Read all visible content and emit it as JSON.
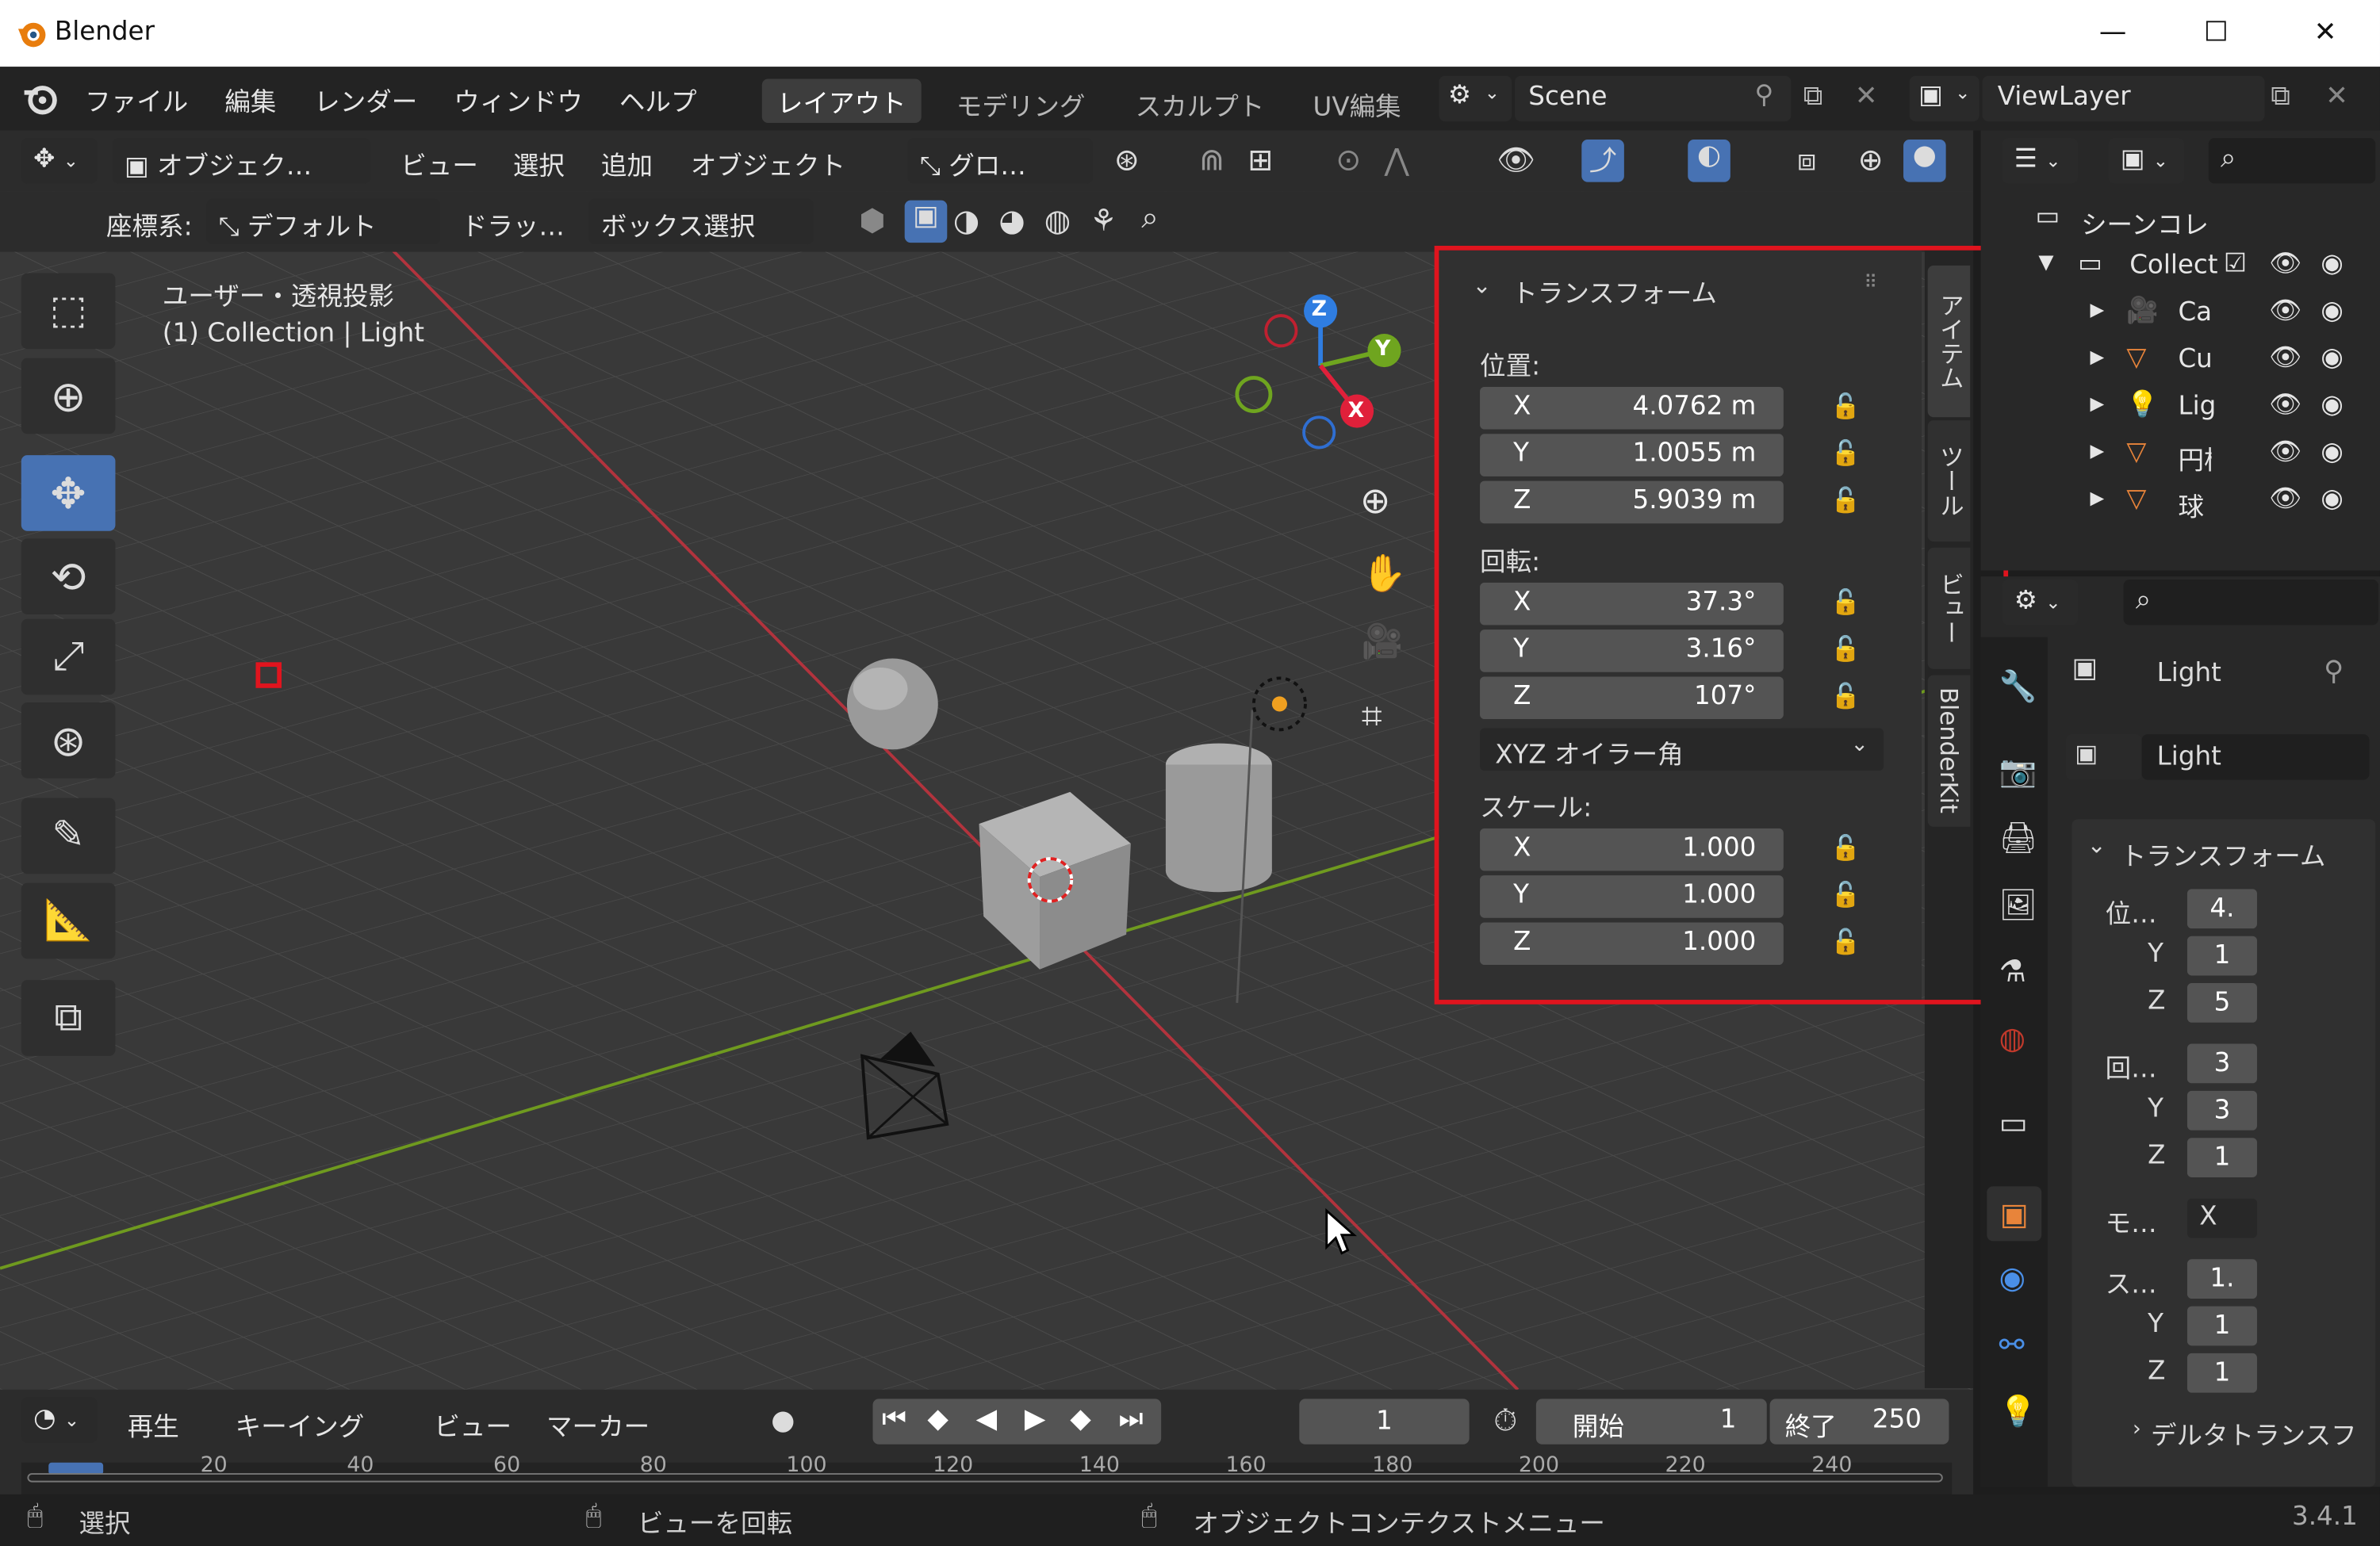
{
  "window": {
    "title": "Blender",
    "minimize": "—",
    "maximize": "☐",
    "close": "✕"
  },
  "menu": [
    "ファイル",
    "編集",
    "レンダー",
    "ウィンドウ",
    "ヘルプ"
  ],
  "workspaces": [
    "レイアウト",
    "モデリング",
    "スカルプト",
    "UV編集"
  ],
  "scene": {
    "name": "Scene"
  },
  "viewlayer": {
    "name": "ViewLayer"
  },
  "viewport_header": {
    "mode": "オブジェク…",
    "items": [
      "ビュー",
      "選択",
      "追加",
      "オブジェクト"
    ],
    "orientation": "グロ…"
  },
  "tool_header": {
    "coord_label": "座標系:",
    "coord_value": "デフォルト",
    "drag_label": "ドラッ…",
    "select_mode": "ボックス選択"
  },
  "viewport_info": {
    "line1": "ユーザー・透視投影",
    "line2": "(1) Collection | Light"
  },
  "gizmo": {
    "z": "Z",
    "y": "Y",
    "x": "X"
  },
  "npanel": {
    "title": "トランスフォーム",
    "location_label": "位置:",
    "location": [
      {
        "axis": "X",
        "value": "4.0762 m"
      },
      {
        "axis": "Y",
        "value": "1.0055 m"
      },
      {
        "axis": "Z",
        "value": "5.9039 m"
      }
    ],
    "rotation_label": "回転:",
    "rotation": [
      {
        "axis": "X",
        "value": "37.3°"
      },
      {
        "axis": "Y",
        "value": "3.16°"
      },
      {
        "axis": "Z",
        "value": "107°"
      }
    ],
    "rotation_mode": "XYZ オイラー角",
    "scale_label": "スケール:",
    "scale": [
      {
        "axis": "X",
        "value": "1.000"
      },
      {
        "axis": "Y",
        "value": "1.000"
      },
      {
        "axis": "Z",
        "value": "1.000"
      }
    ]
  },
  "sidebar_tabs": [
    "アイテム",
    "ツール",
    "ビュー",
    "BlenderKit"
  ],
  "outliner": {
    "scene_collection": "シーンコレ",
    "collection": "Collect",
    "items": [
      "Ca",
      "Cu",
      "Lig",
      "円柱",
      "球"
    ]
  },
  "properties": {
    "object_name": "Light",
    "data_name": "Light",
    "transform_title": "トランスフォーム",
    "loc_label": "位…",
    "loc": [
      "4.",
      "1",
      "5"
    ],
    "rot_label": "回…",
    "rot": [
      "3",
      "3",
      "1"
    ],
    "mode_label": "モ…",
    "mode_value": "X",
    "scale_label": "ス…",
    "scale": [
      "1.",
      "1",
      "1"
    ],
    "axis_y": "Y",
    "axis_z": "Z",
    "delta": "デルタトランスフ"
  },
  "timeline": {
    "play": "再生",
    "keying": "キーイング",
    "view": "ビュー",
    "marker": "マーカー",
    "current_frame": "1",
    "start_label": "開始",
    "start": "1",
    "end_label": "終了",
    "end": "250",
    "ruler": [
      "20",
      "40",
      "60",
      "80",
      "100",
      "120",
      "140",
      "160",
      "180",
      "200",
      "220",
      "240"
    ]
  },
  "status": {
    "select": "選択",
    "rotate": "ビューを回転",
    "context": "オブジェクトコンテクストメニュー",
    "version": "3.4.1"
  }
}
